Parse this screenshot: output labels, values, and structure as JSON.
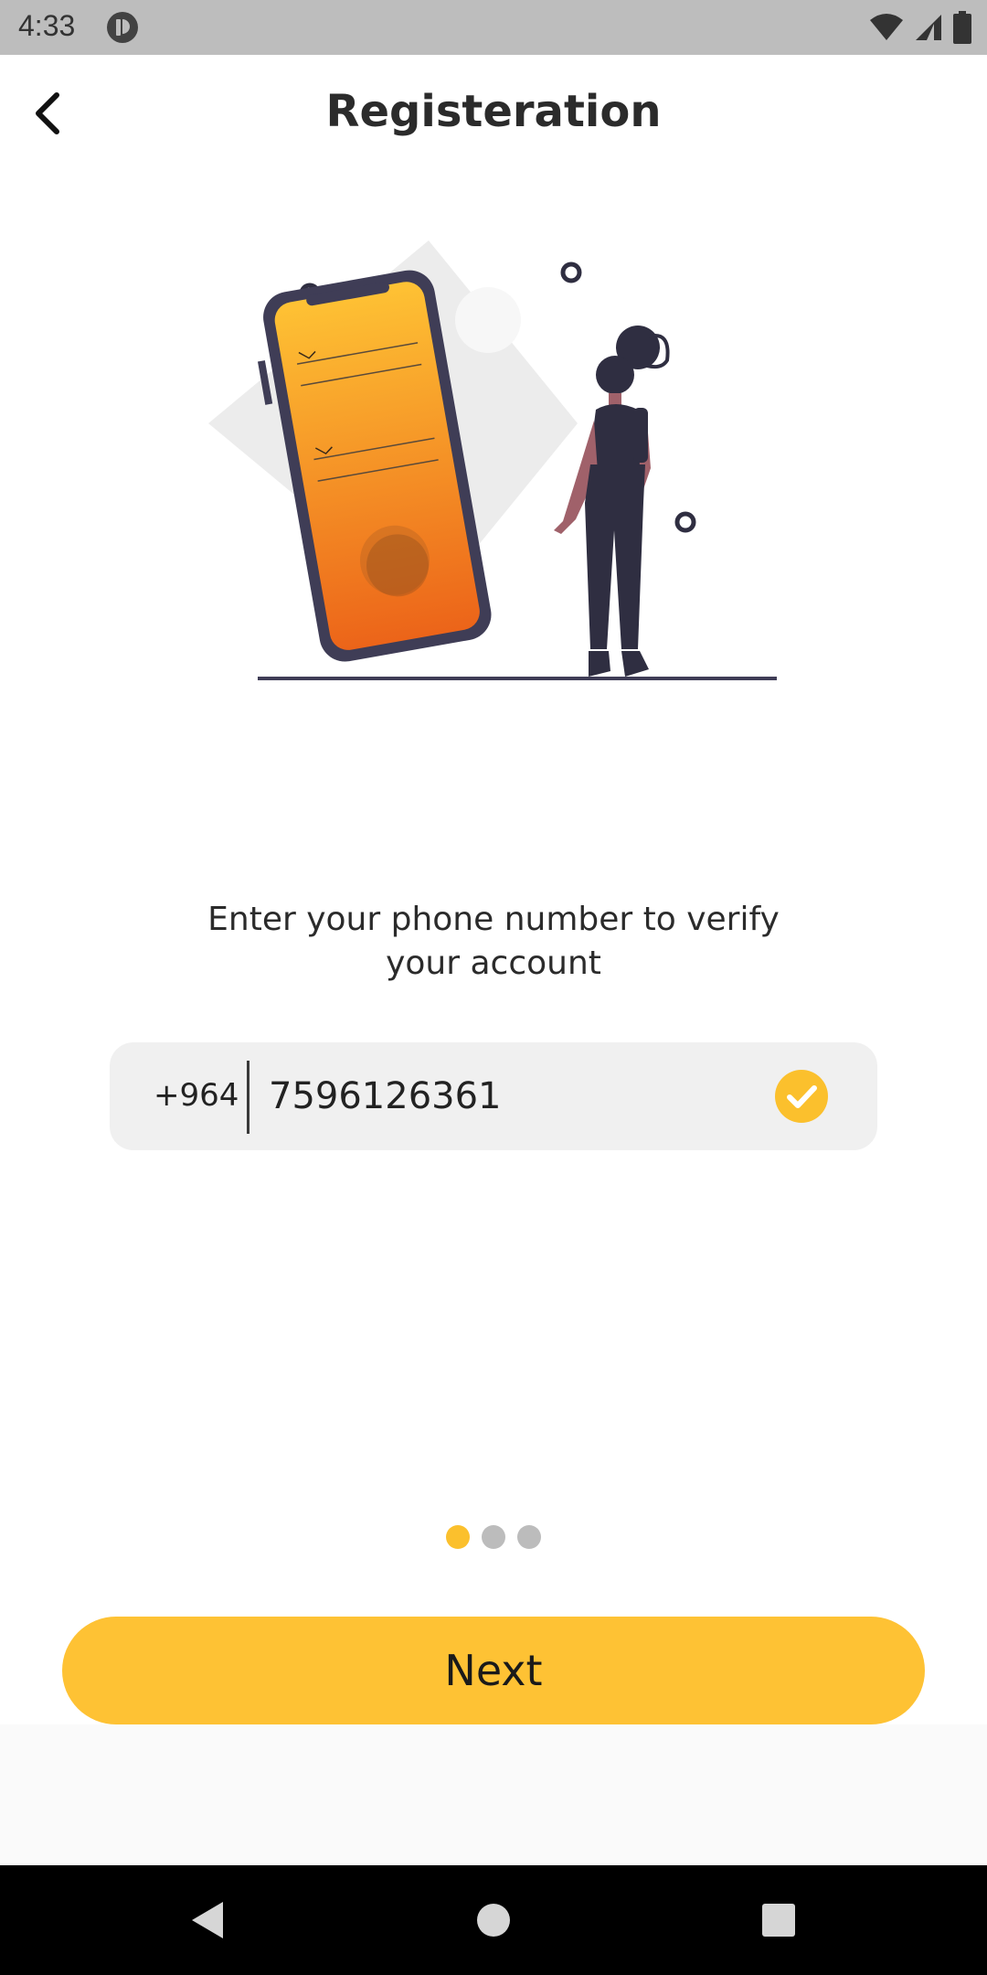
{
  "status_bar": {
    "time": "4:33",
    "icons": [
      "app-notification-icon",
      "wifi-icon",
      "signal-icon",
      "battery-icon"
    ]
  },
  "app_bar": {
    "title": "Registeration",
    "back_icon": "chevron-left-icon"
  },
  "instruction": {
    "line1": "Enter your phone number to verify",
    "line2": "your account"
  },
  "phone": {
    "country_code": "+964",
    "value": "7596126361",
    "verified_icon": "check-circle-icon"
  },
  "pager": {
    "total": 3,
    "active": 1
  },
  "next_button": {
    "label": "Next"
  },
  "nav_bar": {
    "icons": [
      "back-triangle-icon",
      "home-circle-icon",
      "recents-square-icon"
    ]
  },
  "colors": {
    "accent": "#fec234",
    "dot_active": "#fbc02d",
    "dot_inactive": "#bcbcbc",
    "field_bg": "#f0f0f0",
    "status_bar": "#bdbdbd",
    "phone_gradient_top": "#fec234",
    "phone_gradient_bottom": "#ec6419",
    "figure_dark": "#2f2e41"
  }
}
